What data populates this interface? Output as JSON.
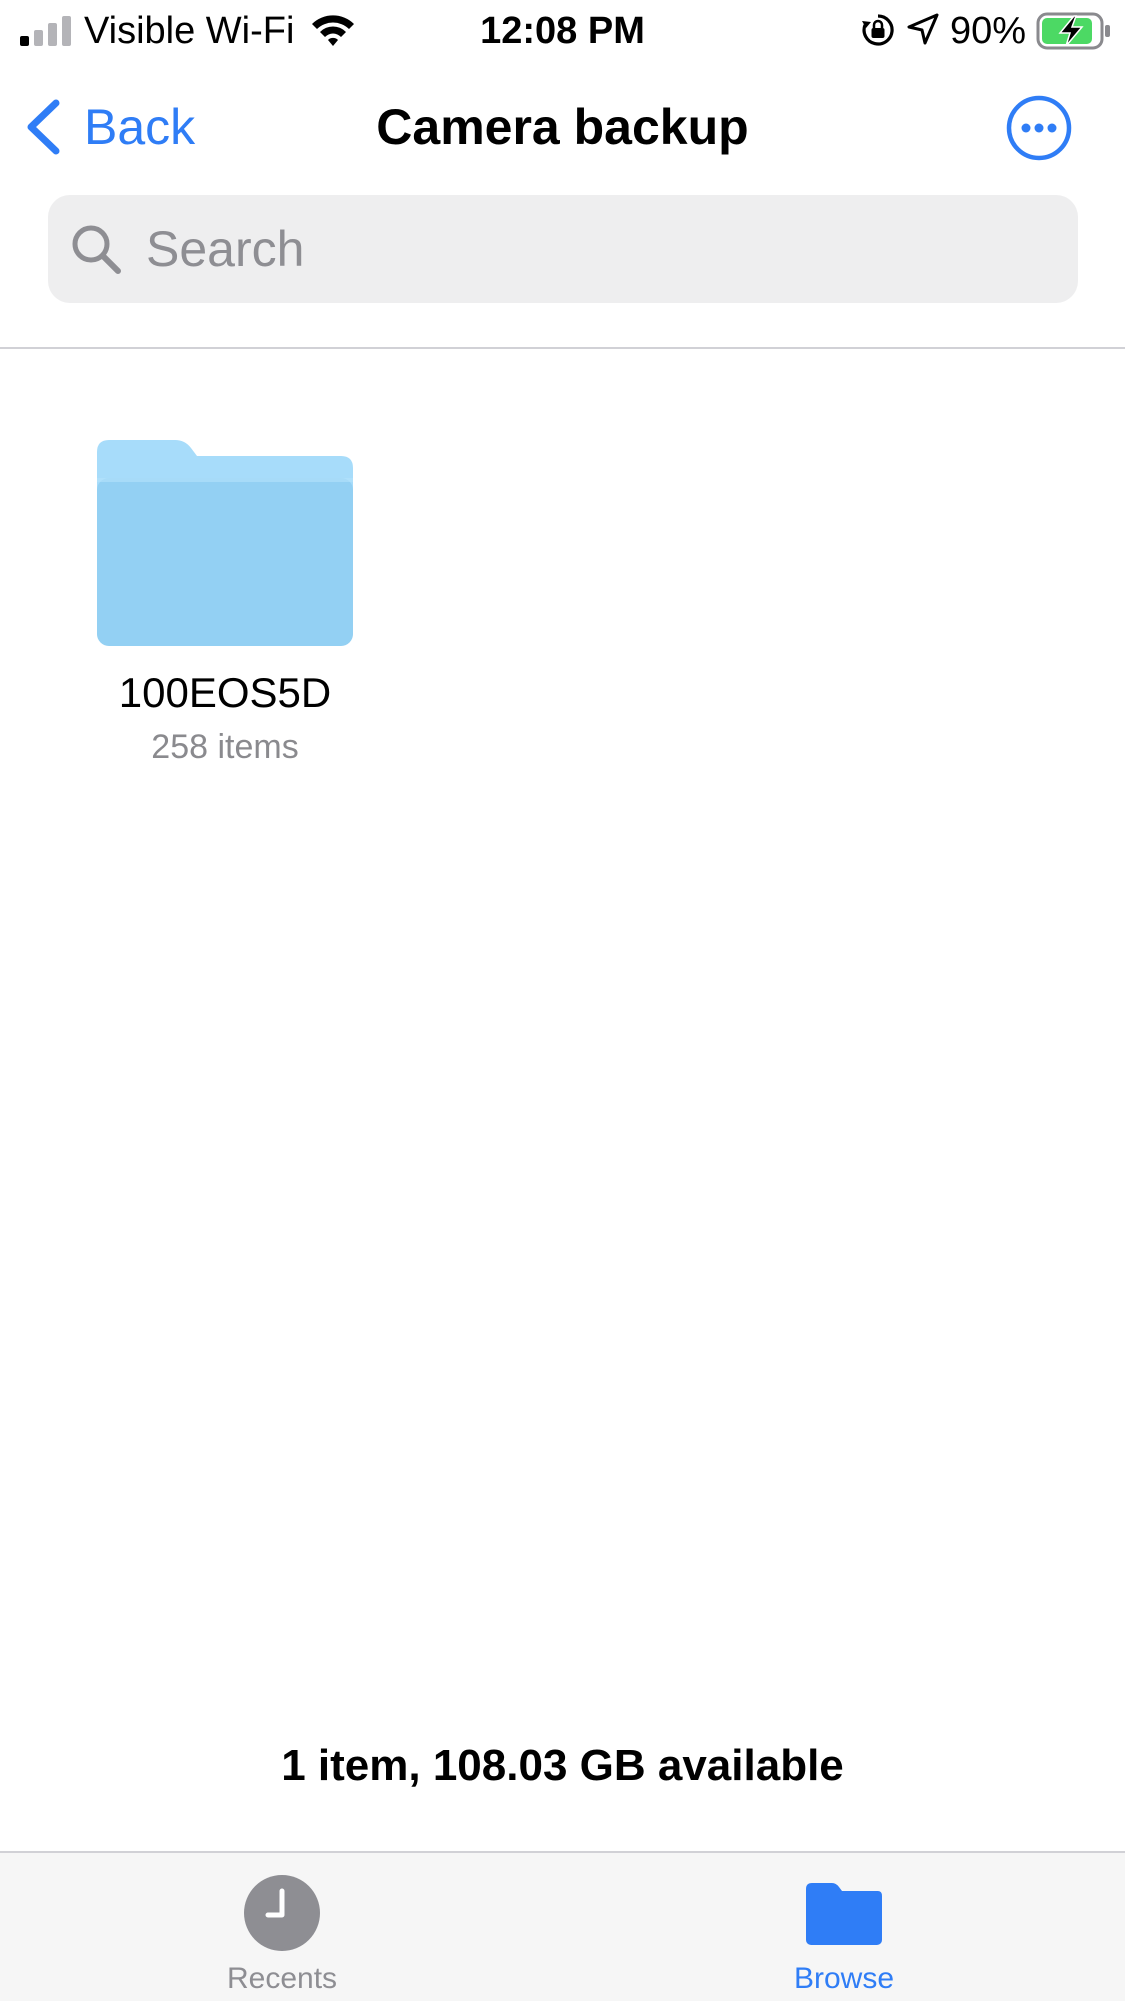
{
  "status_bar": {
    "carrier": "Visible Wi-Fi",
    "time": "12:08 PM",
    "battery_percent": "90%",
    "signal_bars_active": 1,
    "signal_bars_total": 4,
    "battery_level": 0.9,
    "battery_charging": true,
    "icons": [
      "signal-icon",
      "wifi-icon",
      "orientation-lock-icon",
      "location-arrow-icon",
      "battery-icon"
    ]
  },
  "nav": {
    "back_label": "Back",
    "title": "Camera backup",
    "more_icon": "ellipsis-circle-icon"
  },
  "search": {
    "placeholder": "Search",
    "value": ""
  },
  "items": [
    {
      "name": "100EOS5D",
      "subtitle": "258 items",
      "icon": "folder-icon"
    }
  ],
  "summary": "1 item, 108.03 GB available",
  "tabs": [
    {
      "label": "Recents",
      "icon": "clock-icon",
      "selected": false
    },
    {
      "label": "Browse",
      "icon": "folder-icon",
      "selected": true
    }
  ],
  "colors": {
    "accent": "#2f7df6",
    "folder_light": "#a7dcfa",
    "folder_front": "#93d0f3",
    "battery_green": "#4cd964",
    "secondary_text": "#8e8e93",
    "search_bg": "#eeeeef",
    "tab_bar_bg": "#f6f6f6"
  }
}
